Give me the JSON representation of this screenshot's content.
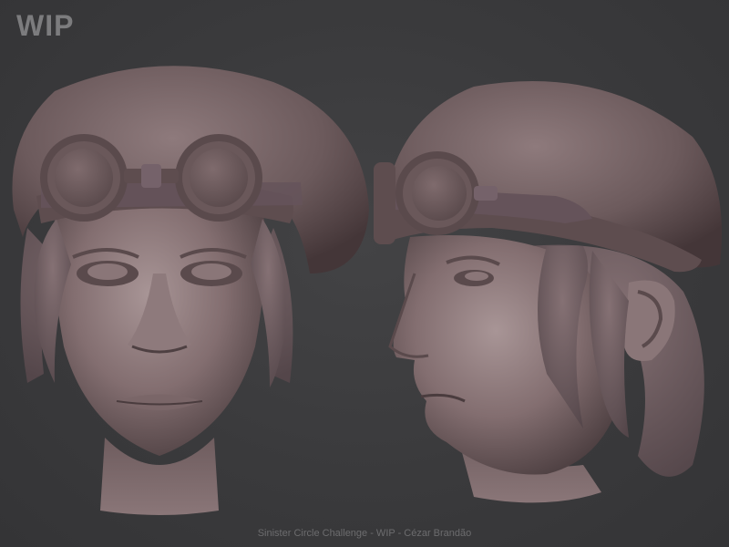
{
  "overlay": {
    "title": "WIP",
    "caption": "Sinister Circle Challenge - WIP - Cézar Brandão"
  },
  "colors": {
    "background": "#3a3a3c",
    "clay": "#756264",
    "clay_light": "#9a8687",
    "clay_dark": "#4a3c3e",
    "label": "#7c7c7e"
  },
  "views": [
    {
      "id": "front",
      "subject": "sculpted head with beret and goggles"
    },
    {
      "id": "three-quarter",
      "subject": "sculpted head with beret and goggles"
    }
  ]
}
